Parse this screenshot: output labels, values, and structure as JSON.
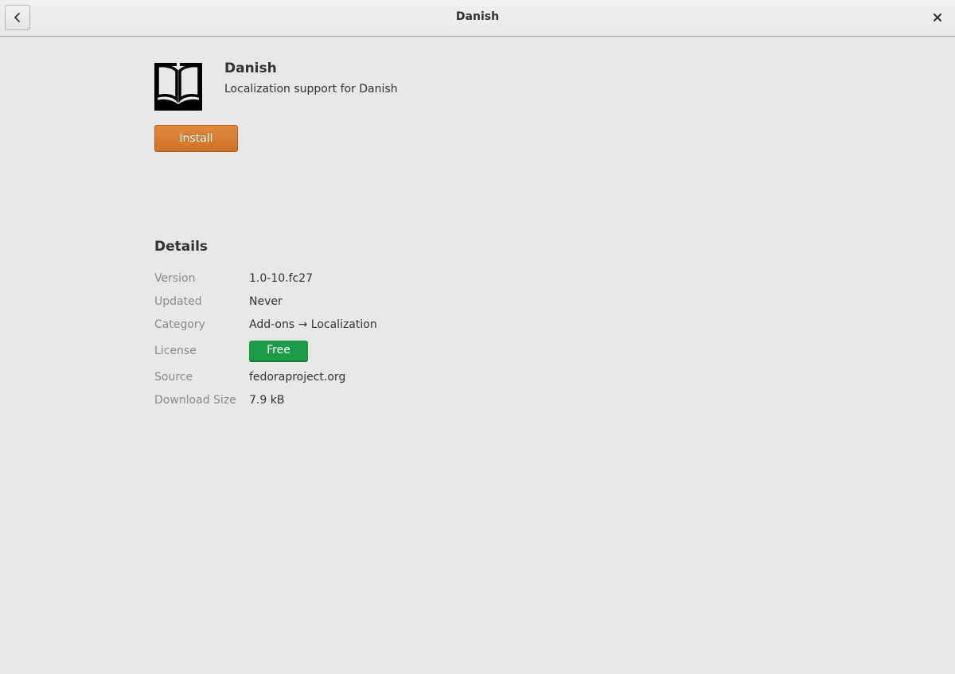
{
  "window": {
    "title": "Danish",
    "back_icon": "chevron-left-icon",
    "close_icon": "close-icon"
  },
  "app": {
    "icon": "book-icon",
    "name": "Danish",
    "summary": "Localization support for Danish",
    "install_label": "Install"
  },
  "details": {
    "heading": "Details",
    "version_label": "Version",
    "version_value": "1.0-10.fc27",
    "updated_label": "Updated",
    "updated_value": "Never",
    "category_label": "Category",
    "category_value": "Add-ons → Localization",
    "license_label": "License",
    "license_value": "Free",
    "source_label": "Source",
    "source_value": "fedoraproject.org",
    "download_size_label": "Download Size",
    "download_size_value": "7.9 kB"
  },
  "colors": {
    "install_button": "#d97c33",
    "license_badge": "#1c9a4a",
    "background": "#e8e8e7"
  }
}
